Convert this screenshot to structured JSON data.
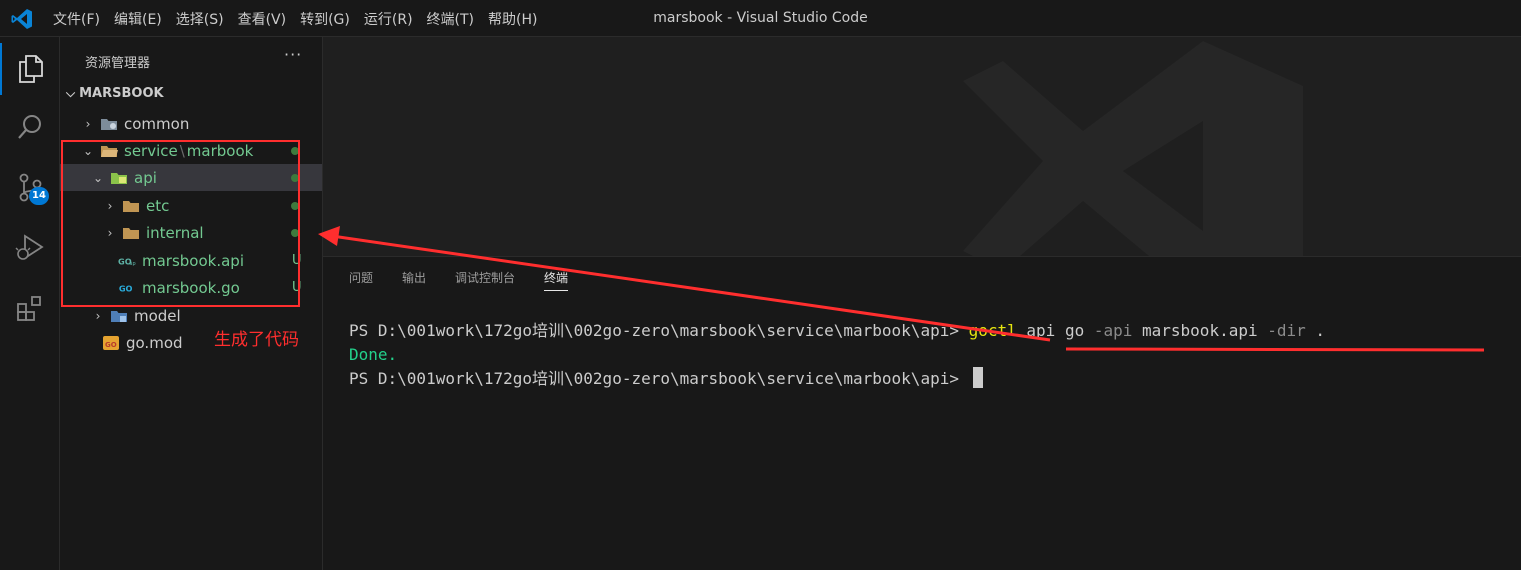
{
  "window": {
    "title": "marsbook - Visual Studio Code"
  },
  "menu": [
    "文件(F)",
    "编辑(E)",
    "选择(S)",
    "查看(V)",
    "转到(G)",
    "运行(R)",
    "终端(T)",
    "帮助(H)"
  ],
  "activity_bar": {
    "scm_badge": "14"
  },
  "explorer": {
    "title": "资源管理器",
    "more": "···",
    "root": "MARSBOOK",
    "items": [
      {
        "label": "common"
      },
      {
        "label": "service",
        "sep": "\\",
        "label2": "marbook"
      },
      {
        "label": "api"
      },
      {
        "label": "etc"
      },
      {
        "label": "internal"
      },
      {
        "label": "marsbook.api",
        "status": "U"
      },
      {
        "label": "marsbook.go",
        "status": "U"
      },
      {
        "label": "model"
      },
      {
        "label": "go.mod"
      }
    ]
  },
  "panel": {
    "tabs": [
      "问题",
      "输出",
      "调试控制台",
      "终端"
    ],
    "active_tab": "终端",
    "terminal": {
      "prompt1": "PS D:\\001work\\172go培训\\002go-zero\\marsbook\\service\\marbook\\api> ",
      "cmd_goctl": "goctl",
      "cmd_mid": " api go ",
      "flag_api": "-api",
      "arg_file": " marsbook.api ",
      "flag_dir": "-dir",
      "arg_dot": " .",
      "done": "Done.",
      "prompt2": "PS D:\\001work\\172go培训\\002go-zero\\marsbook\\service\\marbook\\api> "
    }
  },
  "annotation": {
    "text": "生成了代码",
    "color": "#ff2e2e"
  }
}
